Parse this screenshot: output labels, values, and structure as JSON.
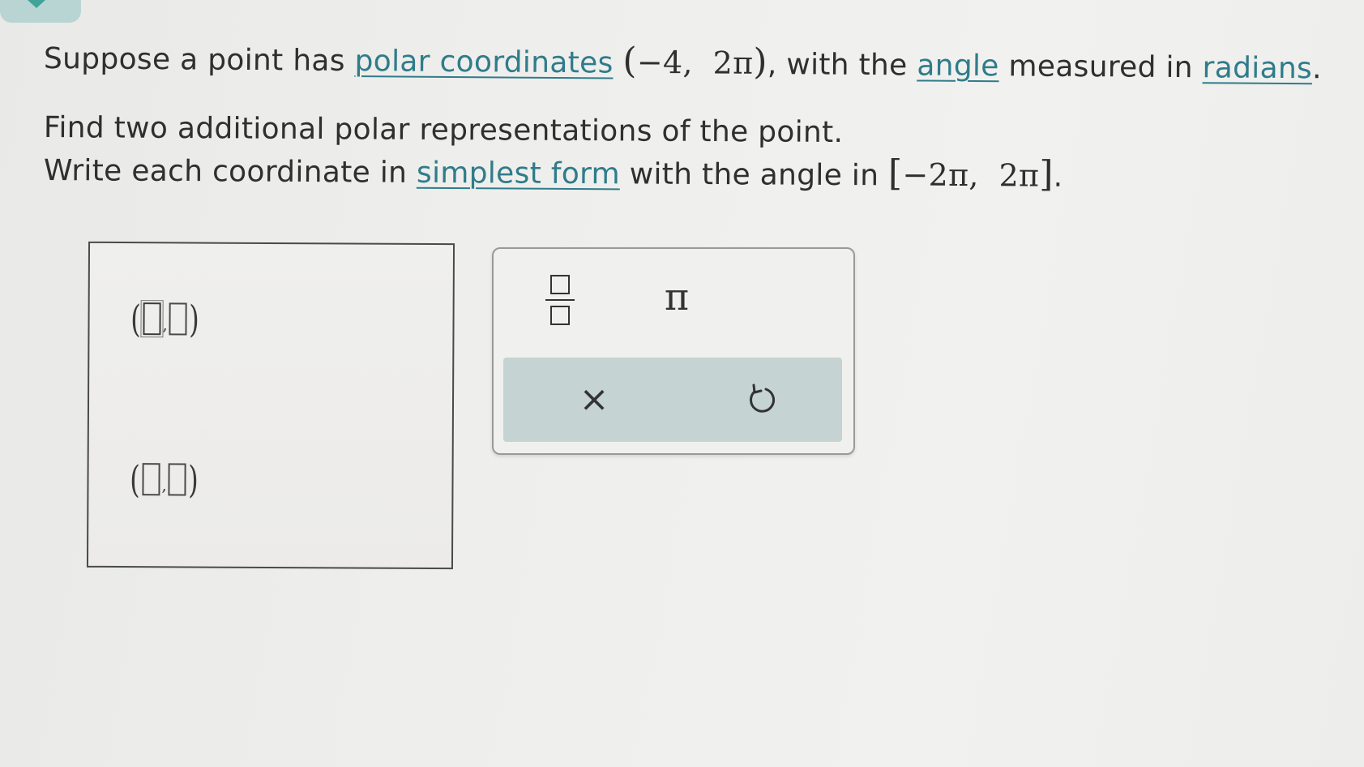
{
  "prompt": {
    "line1_before": "Suppose a point has ",
    "link_polar": "polar coordinates",
    "point_open": "(",
    "point_r": "−4,",
    "point_theta": "2π",
    "point_close": ")",
    "line1_mid": ", with the ",
    "link_angle": "angle",
    "line1_mid2": " measured in ",
    "link_radians": "radians",
    "line1_end": ".",
    "line2": "Find two additional polar representations of the point.",
    "line3_before": "Write each coordinate in ",
    "link_simplest": "simplest form",
    "line3_mid": " with the angle in ",
    "interval_open": "[",
    "interval_low": "−2π,",
    "interval_high": "2π",
    "interval_close": "]",
    "line3_end": "."
  },
  "answer": {
    "open_paren": "(",
    "close_paren": ")",
    "comma": ",",
    "pairs": [
      {
        "r": "",
        "theta": ""
      },
      {
        "r": "",
        "theta": ""
      }
    ]
  },
  "keypad": {
    "pi_label": "π",
    "clear_label": "×"
  },
  "colors": {
    "link": "#2f7c8a",
    "action_bar": "#c5d3d2",
    "accent_tab": "#b9d5d3"
  },
  "icons": {
    "fraction": "fraction-icon",
    "clear": "clear-icon",
    "undo": "undo-icon"
  }
}
